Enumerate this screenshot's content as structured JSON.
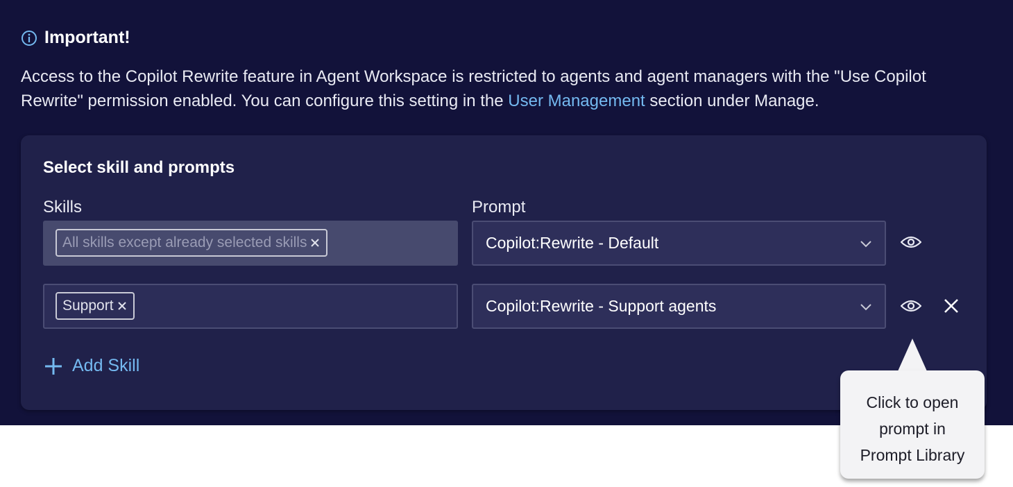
{
  "notice": {
    "title": "Important!",
    "text_before": "Access to the Copilot Rewrite feature in Agent Workspace is restricted to agents and agent managers with the \"Use Copilot Rewrite\" permission enabled. You can configure this setting in the ",
    "link_text": "User Management",
    "text_after": " section under Manage."
  },
  "card": {
    "title": "Select skill and prompts",
    "skills_label": "Skills",
    "prompt_label": "Prompt",
    "rows": [
      {
        "skill_chip": "All skills except already selected skills",
        "prompt": "Copilot:Rewrite - Default"
      },
      {
        "skill_chip": "Support",
        "prompt": "Copilot:Rewrite - Support agents"
      }
    ],
    "add_skill_label": "Add Skill"
  },
  "tooltip": {
    "line1": "Click to open",
    "line2": "prompt in",
    "line3": "Prompt Library"
  },
  "colors": {
    "background": "#12123a",
    "card": "#20214a",
    "accent": "#74b9f0"
  }
}
